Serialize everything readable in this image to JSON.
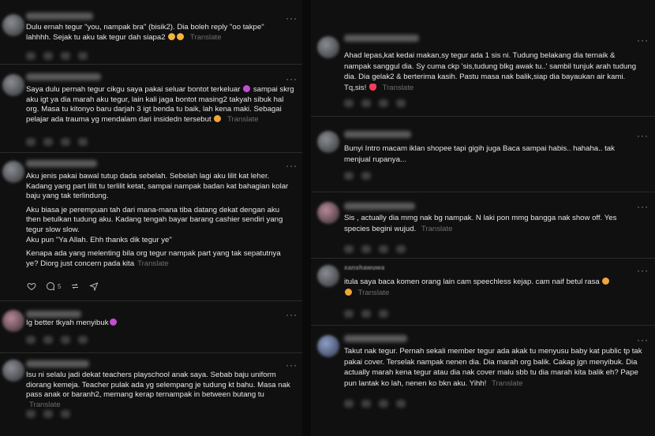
{
  "translate_label": "Translate",
  "more_label": "···",
  "left_posts": [
    {
      "text": "Dulu ernah tegur \"you, nampak bra\" (bisik2). Dia boleh reply \"oo takpe\" lahhhh. Sejak tu aku tak tegur dah siapa2",
      "emojis": [
        "smile",
        "smile"
      ]
    },
    {
      "text": "Saya dulu pernah tegur cikgu saya pakai seluar bontot terkeluar",
      "text2": "sampai skrg aku igt ya dia marah aku tegur, lain kali jaga bontot masing2 takyah sibuk hal org. Masa tu kitonyo baru darjah 3 igt benda tu baik, lah kena maki. Sebagai pelajar ada trauma yg mendalam dari insidedn tersebut"
    },
    {
      "p1": "Aku jenis pakai bawal tutup dada sebelah. Sebelah lagi aku lilit kat leher. Kadang yang part lilit tu terlilit ketat, sampai nampak badan kat bahagian kolar baju yang tak terlindung.",
      "p2": "Aku biasa je perempuan tah dari mana-mana tiba datang dekat dengan aku then betulkan tudung aku. Kadang tengah bayar barang cashier sendiri yang tegur slow slow.",
      "p3": "Aku pun \"Ya Allah. Ehh thanks dik tegur ye\"",
      "p4": "Kenapa ada yang melenting bila org tegur nampak part yang tak sepatutnya ye? Diorg just concern pada kita",
      "reply_count": "5"
    },
    {
      "text": "Ig better tkyah menyibuk"
    },
    {
      "text": "Isu ni selalu jadi dekat teachers playschool anak saya. Sebab baju uniform diorang kemeja. Teacher pulak ada yg selempang je tudung kt bahu. Masa nak pass anak or baranh2, memang kerap ternampak in between butang tu"
    }
  ],
  "right_posts": [
    {
      "text": "Ahad lepas,kat kedai makan,sy tegur ada 1 sis ni. Tudung belakang dia ternaik & nampak sanggul dia. Sy cuma ckp 'sis,tudung blkg awak tu..' sambil tunjuk arah tudung dia. Dia gelak2 & berterima kasih. Pastu masa nak balik,siap dia bayaukan air kami. Tq,sis!"
    },
    {
      "text": "Bunyi Intro macam iklan shopee tapi gigih juga Baca sampai habis.. hahaha.. tak menjual rupanya..."
    },
    {
      "text": "Sis , actually dia mmg nak bg nampak. N laki pon mmg bangga nak show off. Yes species begini wujud."
    },
    {
      "username": "xanshawuwa",
      "text": "itula saya baca komen orang lain cam speechless kejap. cam naif betul rasa"
    },
    {
      "text": "Takut nak tegur. Pernah sekali member tegur ada akak tu menyusu baby kat public tp tak pakai cover. Terselak nampak nenen dia. Dia marah org balik. Cakap jgn menyibuk. Dia actually marah kena tegur atau dia nak cover malu sbb tu dia marah kita balik eh? Pape pun lantak ko lah, nenen ko bkn aku. Yihh!"
    }
  ]
}
